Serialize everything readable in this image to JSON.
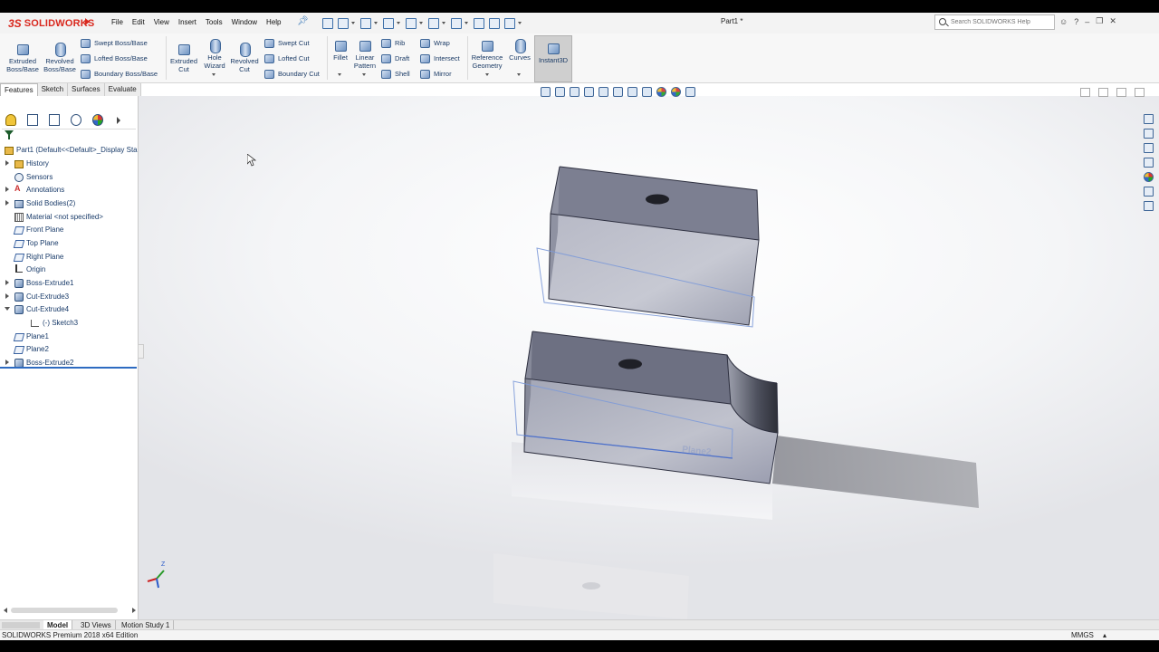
{
  "app": {
    "logo_text": "SOLIDWORKS",
    "doc_title": "Part1 *",
    "search_placeholder": "Search SOLIDWORKS Help",
    "help_symbol": "?"
  },
  "menu": [
    "File",
    "Edit",
    "View",
    "Insert",
    "Tools",
    "Window",
    "Help"
  ],
  "ribbon": {
    "extruded_boss": "Extruded Boss/Base",
    "revolved_boss": "Revolved Boss/Base",
    "swept_boss": "Swept Boss/Base",
    "lofted_boss": "Lofted Boss/Base",
    "boundary_boss": "Boundary Boss/Base",
    "extruded_cut": "Extruded Cut",
    "hole_wizard": "Hole Wizard",
    "revolved_cut": "Revolved Cut",
    "swept_cut": "Swept Cut",
    "lofted_cut": "Lofted Cut",
    "boundary_cut": "Boundary Cut",
    "fillet": "Fillet",
    "linear_pattern": "Linear Pattern",
    "rib": "Rib",
    "draft": "Draft",
    "shell": "Shell",
    "wrap": "Wrap",
    "intersect": "Intersect",
    "mirror": "Mirror",
    "reference_geometry": "Reference Geometry",
    "curves": "Curves",
    "instant3d": "Instant3D"
  },
  "command_tabs": [
    "Features",
    "Sketch",
    "Surfaces",
    "Evaluate"
  ],
  "tree": {
    "root": "Part1  (Default<<Default>_Display Sta",
    "items": [
      {
        "label": "History",
        "icon": "folder-icon",
        "expand": "collapsed"
      },
      {
        "label": "Sensors",
        "icon": "sensor-icon",
        "expand": "none"
      },
      {
        "label": "Annotations",
        "icon": "annotation-icon",
        "expand": "collapsed"
      },
      {
        "label": "Solid Bodies(2)",
        "icon": "solid-bodies-icon",
        "expand": "collapsed"
      },
      {
        "label": "Material <not specified>",
        "icon": "material-icon",
        "expand": "none"
      },
      {
        "label": "Front Plane",
        "icon": "plane-icon",
        "expand": "none"
      },
      {
        "label": "Top Plane",
        "icon": "plane-icon",
        "expand": "none"
      },
      {
        "label": "Right Plane",
        "icon": "plane-icon",
        "expand": "none"
      },
      {
        "label": "Origin",
        "icon": "origin-icon",
        "expand": "none"
      },
      {
        "label": "Boss-Extrude1",
        "icon": "feature-icon",
        "expand": "collapsed"
      },
      {
        "label": "Cut-Extrude3",
        "icon": "feature-icon",
        "expand": "collapsed"
      },
      {
        "label": "Cut-Extrude4",
        "icon": "feature-icon",
        "expand": "expanded"
      },
      {
        "label": "(-) Sketch3",
        "icon": "sketch-icon",
        "expand": "none",
        "child": true
      },
      {
        "label": "Plane1",
        "icon": "plane-icon",
        "expand": "none"
      },
      {
        "label": "Plane2",
        "icon": "plane-icon",
        "expand": "none"
      },
      {
        "label": "Boss-Extrude2",
        "icon": "feature-icon",
        "expand": "collapsed"
      }
    ]
  },
  "graphics": {
    "plane_label_lower": "Plane2",
    "triad_label": "Z"
  },
  "bottom_tabs": [
    "Model",
    "3D Views",
    "Motion Study 1"
  ],
  "status": {
    "edition": "SOLIDWORKS Premium 2018 x64 Edition",
    "units": "MMGS"
  },
  "colors": {
    "brand": "#d9281e",
    "accent": "#2e6bc1",
    "part_face_top": "#7c7f91",
    "part_face_front": "#b0b2bf"
  }
}
